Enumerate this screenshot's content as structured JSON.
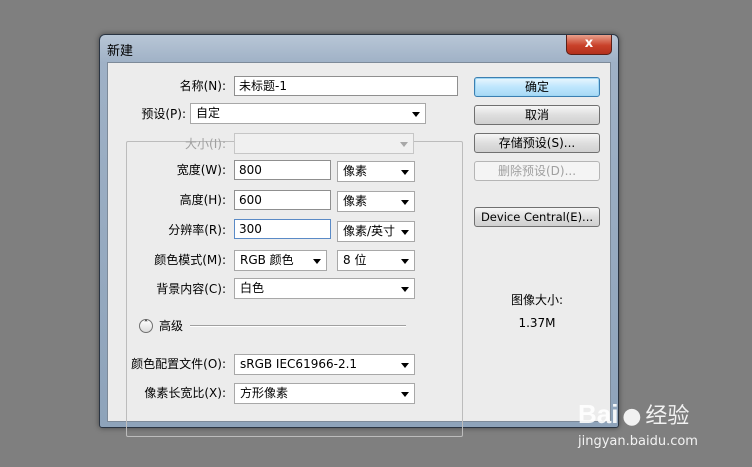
{
  "dialog": {
    "title": "新建",
    "close_glyph": "x"
  },
  "form": {
    "name_label": "名称(N):",
    "name_value": "未标题-1",
    "preset_label": "预设(P):",
    "preset_value": "自定",
    "size_label": "大小(I):",
    "size_value": "",
    "width_label": "宽度(W):",
    "width_value": "800",
    "width_unit": "像素",
    "height_label": "高度(H):",
    "height_value": "600",
    "height_unit": "像素",
    "resolution_label": "分辨率(R):",
    "resolution_value": "300",
    "resolution_unit": "像素/英寸",
    "color_mode_label": "颜色模式(M):",
    "color_mode_value": "RGB 颜色",
    "bit_depth_value": "8 位",
    "background_label": "背景内容(C):",
    "background_value": "白色",
    "advanced_label": "高级",
    "color_profile_label": "颜色配置文件(O):",
    "color_profile_value": "sRGB IEC61966-2.1",
    "pixel_aspect_label": "像素长宽比(X):",
    "pixel_aspect_value": "方形像素"
  },
  "buttons": {
    "ok": "确定",
    "cancel": "取消",
    "save_preset": "存储预设(S)...",
    "delete_preset": "删除预设(D)...",
    "device_central": "Device Central(E)..."
  },
  "info": {
    "image_size_label": "图像大小:",
    "image_size_value": "1.37M"
  },
  "watermark": {
    "brand": "Bai",
    "brand2": "经验",
    "url": "jingyan.baidu.com"
  }
}
